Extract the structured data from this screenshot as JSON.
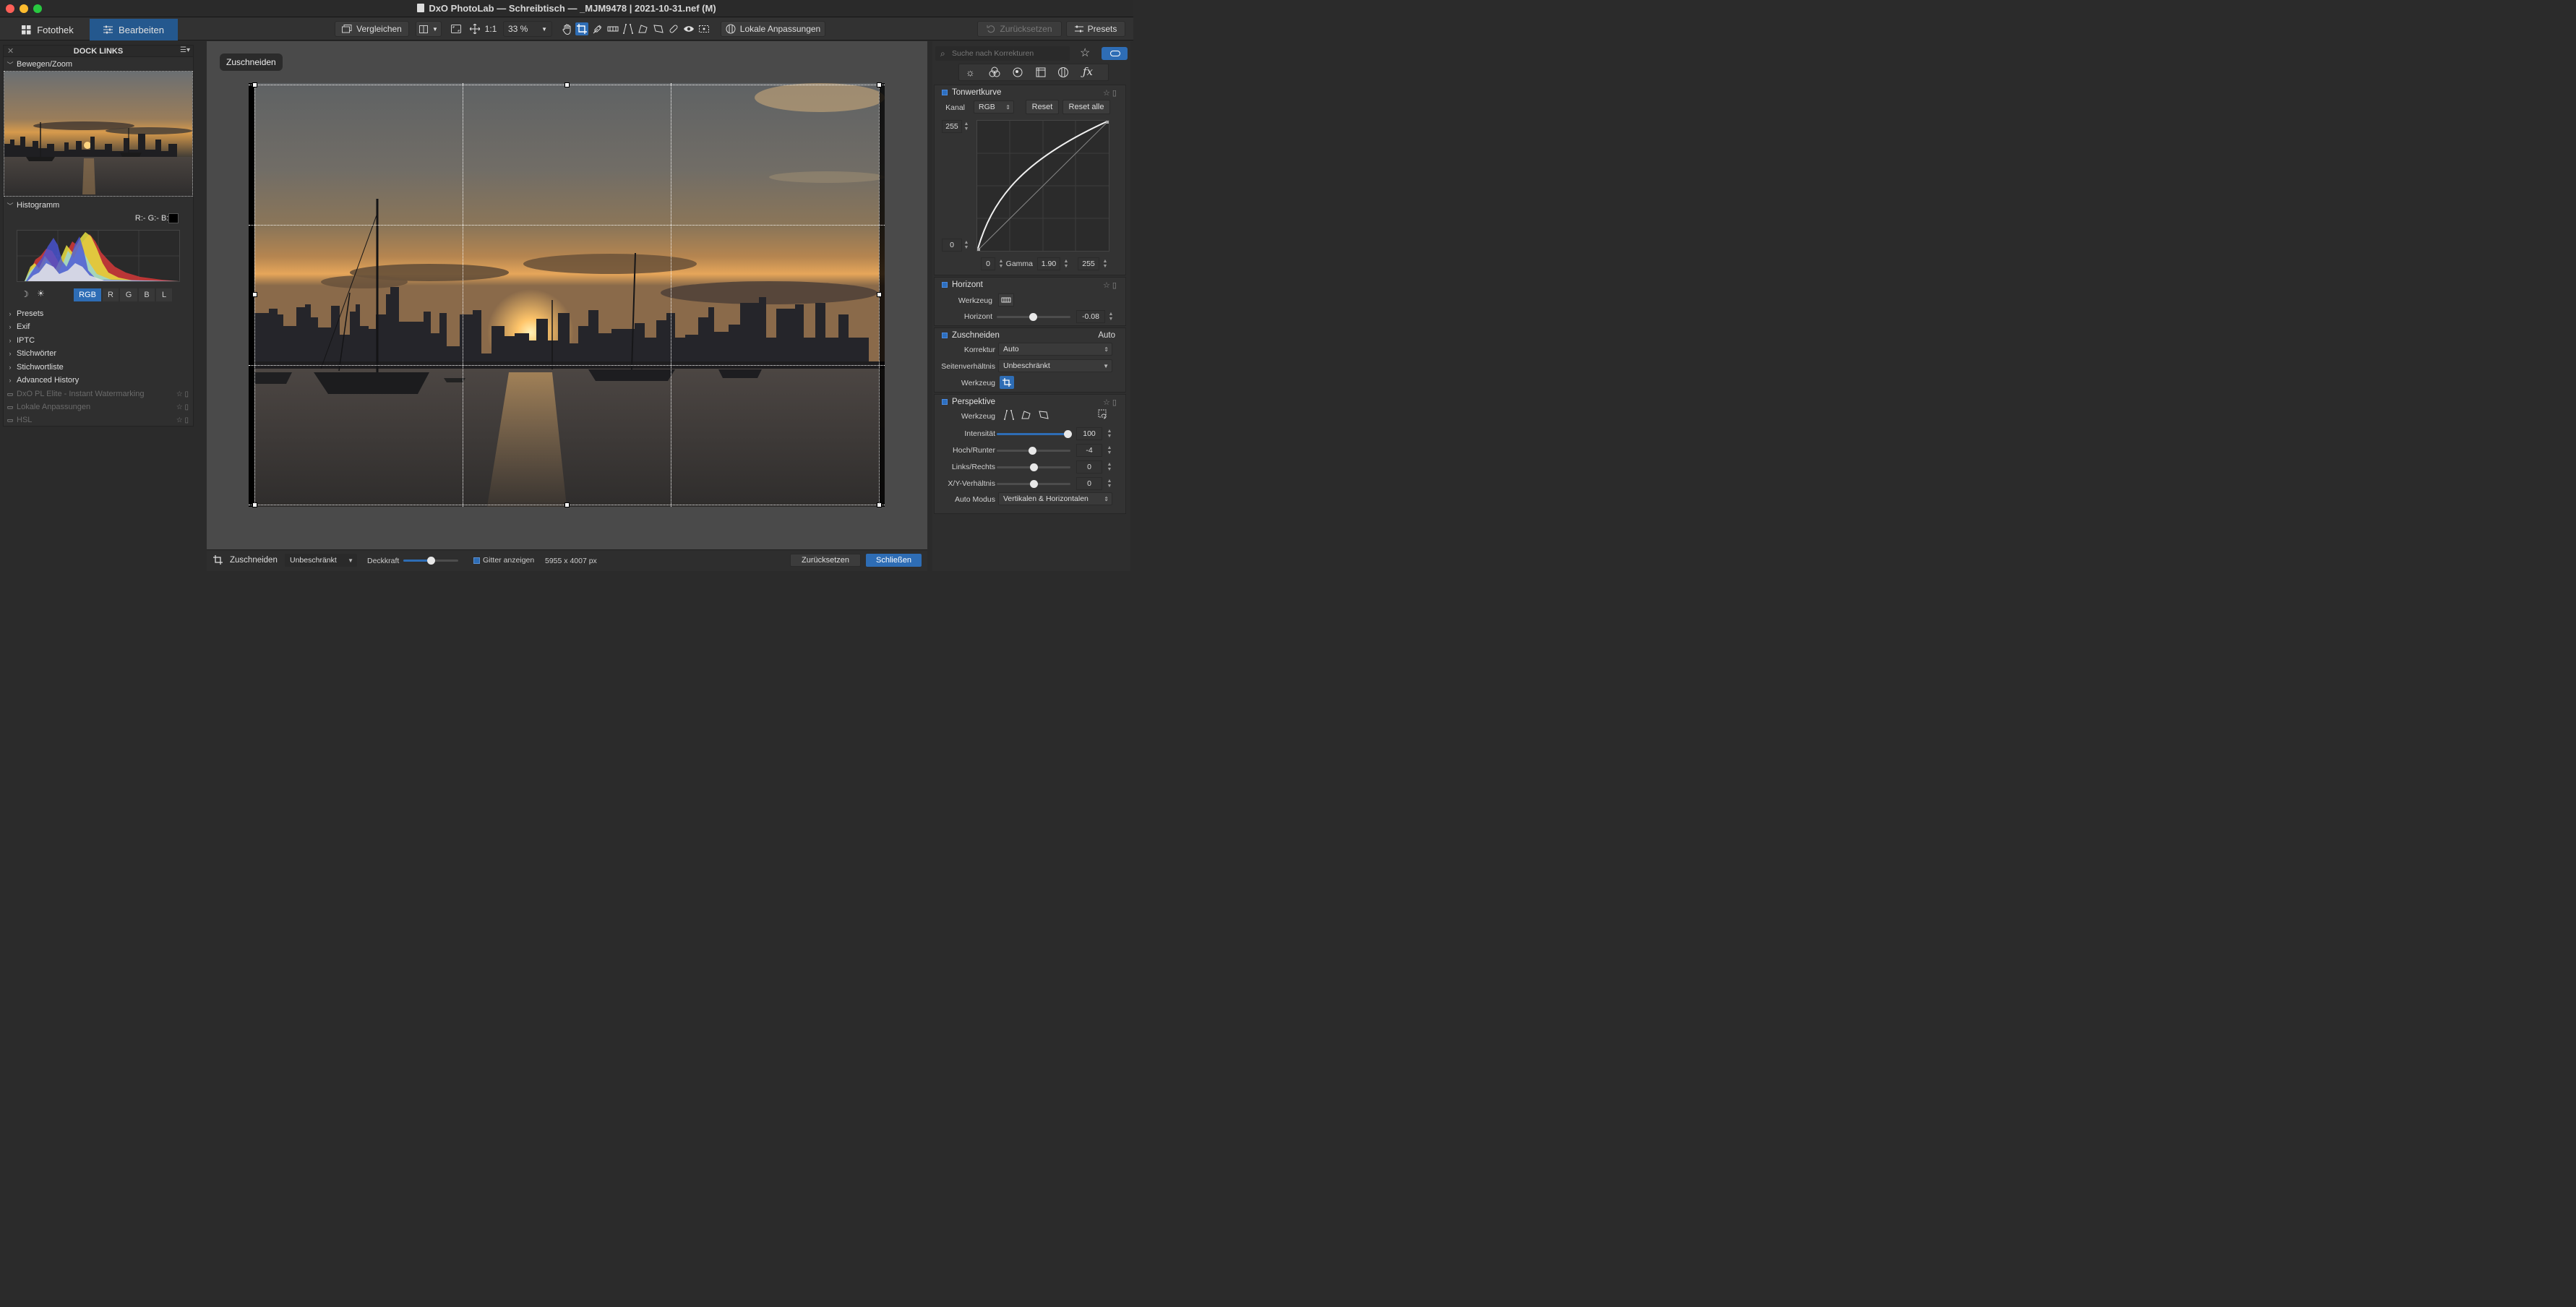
{
  "window": {
    "title": "DxO PhotoLab — Schreibtisch — _MJM9478 | 2021-10-31.nef (M)"
  },
  "toolbar": {
    "tab_library": "Fotothek",
    "tab_edit": "Bearbeiten",
    "compare_label": "Vergleichen",
    "one_to_one": "1:1",
    "zoom_value": "33 %",
    "local_adjustments": "Lokale Anpassungen",
    "reset_label": "Zurücksetzen",
    "presets_label": "Presets"
  },
  "left_dock": {
    "title": "DOCK LINKS",
    "move_zoom": "Bewegen/Zoom",
    "histogram": "Histogramm",
    "rgb_readout": "R:- G:- B:-",
    "channels": [
      "RGB",
      "R",
      "G",
      "B",
      "L"
    ],
    "sections": [
      "Presets",
      "Exif",
      "IPTC",
      "Stichwörter",
      "Stichwortliste",
      "Advanced History"
    ],
    "disabled_sections": [
      "DxO PL Elite - Instant Watermarking",
      "Lokale Anpassungen",
      "HSL"
    ]
  },
  "center": {
    "crop_badge": "Zuschneiden"
  },
  "bottombar": {
    "crop_label": "Zuschneiden",
    "ratio_value": "Unbeschränkt",
    "opacity_label": "Deckkraft",
    "opacity": 0.5,
    "show_grid_label": "Gitter anzeigen",
    "dimensions": "5955 x 4007 px",
    "reset_button": "Zurücksetzen",
    "close_button": "Schließen"
  },
  "right_panel": {
    "search_placeholder": "Suche nach Korrekturen",
    "tone_curve": {
      "title": "Tonwertkurve",
      "channel_label": "Kanal",
      "channel_value": "RGB",
      "reset": "Reset",
      "reset_all": "Reset alle",
      "out_max": "255",
      "out_min": "0",
      "in_min": "0",
      "gamma_label": "Gamma",
      "gamma_value": "1.90",
      "in_max": "255"
    },
    "horizon": {
      "title": "Horizont",
      "tool_label": "Werkzeug",
      "horizon_label": "Horizont",
      "horizon_value": "-0.08"
    },
    "crop": {
      "title": "Zuschneiden",
      "mode": "Auto",
      "correction_label": "Korrektur",
      "correction_value": "Auto",
      "ratio_label": "Seitenverhältnis",
      "ratio_value": "Unbeschränkt",
      "tool_label": "Werkzeug"
    },
    "perspective": {
      "title": "Perspektive",
      "tool_label": "Werkzeug",
      "intensity_label": "Intensität",
      "intensity_value": "100",
      "updown_label": "Hoch/Runter",
      "updown_value": "-4",
      "leftright_label": "Links/Rechts",
      "leftright_value": "0",
      "xy_label": "X/Y-Verhältnis",
      "xy_value": "0",
      "auto_label": "Auto Modus",
      "auto_value": "Vertikalen & Horizontalen"
    }
  },
  "colors": {
    "accent": "#2e6db5",
    "active_tab": "#24588e"
  }
}
